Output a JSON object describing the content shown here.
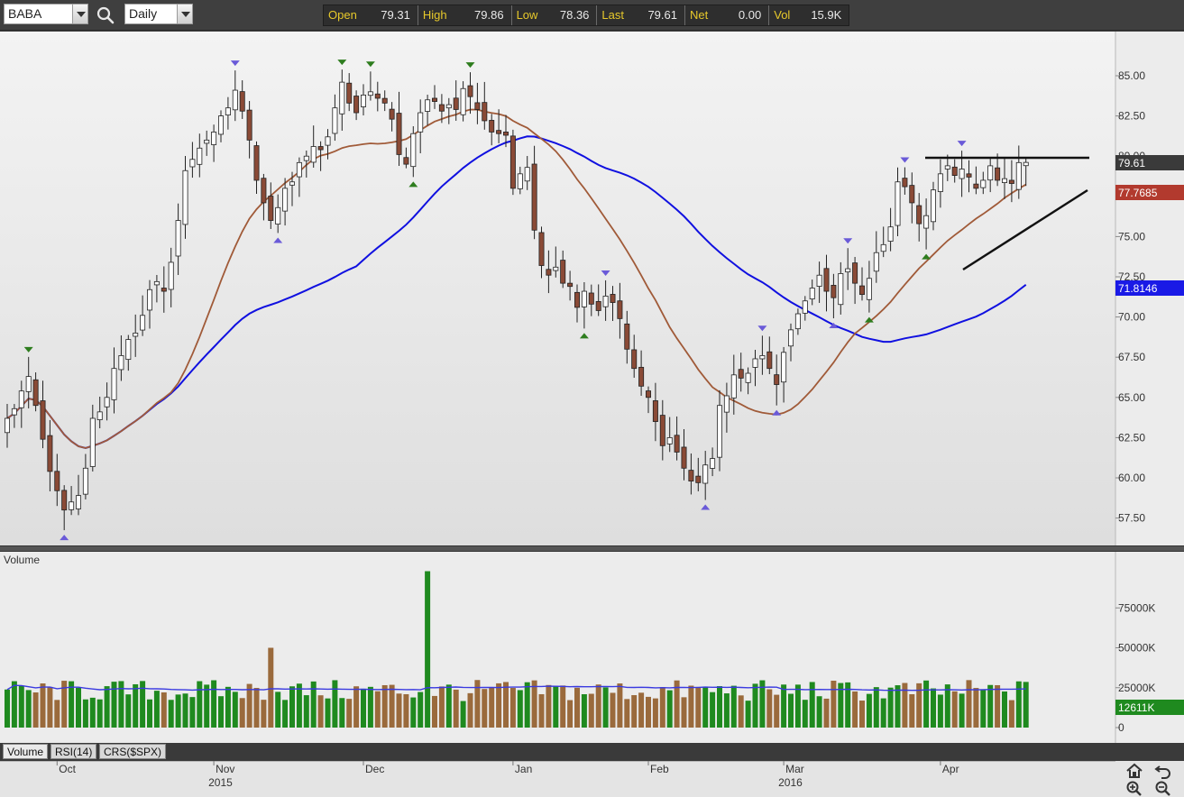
{
  "toolbar": {
    "symbol": "BABA",
    "interval": "Daily",
    "quote": [
      {
        "label": "Open",
        "value": "79.31"
      },
      {
        "label": "High",
        "value": "79.86"
      },
      {
        "label": "Low",
        "value": "78.36"
      },
      {
        "label": "Last",
        "value": "79.61"
      },
      {
        "label": "Net",
        "value": "0.00"
      },
      {
        "label": "Vol",
        "value": "15.9K"
      }
    ]
  },
  "price_panel": {
    "axis_labels": [
      "85.00",
      "82.50",
      "80.00",
      "77.50",
      "75.00",
      "72.50",
      "70.00",
      "67.50",
      "65.00",
      "62.50",
      "60.00",
      "57.50"
    ],
    "last_price_badge": "79.61",
    "sma_fast_badge": "77.7685",
    "sma_slow_badge": "71.8146",
    "colors": {
      "up": "#ffffff",
      "down": "#8a4a36",
      "sma_fast": "#a05a38",
      "sma_slow": "#1010e0",
      "badge_last": "#3a3a3a",
      "badge_fast": "#b23a2e",
      "badge_slow": "#1a1ae6"
    }
  },
  "volume_panel": {
    "title": "Volume",
    "axis_labels": [
      "75000K",
      "50000K",
      "25000K",
      "0"
    ],
    "last_volume_badge": "12611K",
    "colors": {
      "up": "#1f8a1f",
      "down": "#9a6a3c",
      "avg": "#3a3ae0"
    }
  },
  "tabs": [
    "Volume",
    "RSI(14)",
    "CRS($SPX)"
  ],
  "x_axis": {
    "months": [
      "Oct",
      "Nov",
      "Dec",
      "Jan",
      "Feb",
      "Mar",
      "Apr"
    ],
    "years": [
      "2015",
      "2016"
    ]
  },
  "nav": {
    "icons": [
      "home-icon",
      "undo-icon",
      "zoom-in-icon",
      "zoom-out-icon"
    ]
  },
  "chart_data": {
    "type": "candlestick",
    "symbol": "BABA",
    "interval": "Daily",
    "ylim": [
      56,
      87
    ],
    "x": [
      "Sep 22",
      "Sep 23",
      "Sep 24",
      "Sep 25",
      "Sep 28",
      "Sep 29",
      "Sep 30",
      "Oct 1",
      "Oct 2",
      "Oct 5",
      "Oct 6",
      "Oct 7",
      "Oct 8",
      "Oct 9",
      "Oct 12",
      "Oct 13",
      "Oct 14",
      "Oct 15",
      "Oct 16",
      "Oct 19",
      "Oct 20",
      "Oct 21",
      "Oct 22",
      "Oct 23",
      "Oct 26",
      "Oct 27",
      "Oct 28",
      "Oct 29",
      "Oct 30",
      "Nov 2",
      "Nov 3",
      "Nov 4",
      "Nov 5",
      "Nov 6",
      "Nov 9",
      "Nov 10",
      "Nov 11",
      "Nov 12",
      "Nov 13",
      "Nov 16",
      "Nov 17",
      "Nov 18",
      "Nov 19",
      "Nov 20",
      "Nov 23",
      "Nov 24",
      "Nov 25",
      "Nov 27",
      "Nov 30",
      "Dec 1",
      "Dec 2",
      "Dec 3",
      "Dec 4",
      "Dec 7",
      "Dec 8",
      "Dec 9",
      "Dec 10",
      "Dec 11",
      "Dec 14",
      "Dec 15",
      "Dec 16",
      "Dec 17",
      "Dec 18",
      "Dec 21",
      "Dec 22",
      "Dec 23",
      "Dec 24",
      "Dec 28",
      "Dec 29",
      "Dec 30",
      "Dec 31",
      "Jan 4",
      "Jan 5",
      "Jan 6",
      "Jan 7",
      "Jan 8",
      "Jan 11",
      "Jan 12",
      "Jan 13",
      "Jan 14",
      "Jan 15",
      "Jan 19",
      "Jan 20",
      "Jan 21",
      "Jan 22",
      "Jan 25",
      "Jan 26",
      "Jan 27",
      "Jan 28",
      "Jan 29",
      "Feb 1",
      "Feb 2",
      "Feb 3",
      "Feb 4",
      "Feb 5",
      "Feb 8",
      "Feb 9",
      "Feb 10",
      "Feb 11",
      "Feb 12",
      "Feb 16",
      "Feb 17",
      "Feb 18",
      "Feb 19",
      "Feb 22",
      "Feb 23",
      "Feb 24",
      "Feb 25",
      "Feb 26",
      "Feb 29",
      "Mar 1",
      "Mar 2",
      "Mar 3",
      "Mar 4",
      "Mar 7",
      "Mar 8",
      "Mar 9",
      "Mar 10",
      "Mar 11",
      "Mar 14",
      "Mar 15",
      "Mar 16",
      "Mar 17",
      "Mar 18",
      "Mar 21",
      "Mar 22",
      "Mar 23",
      "Mar 24",
      "Mar 28",
      "Mar 29",
      "Mar 30",
      "Mar 31",
      "Apr 1",
      "Apr 4",
      "Apr 5",
      "Apr 6",
      "Apr 7",
      "Apr 8",
      "Apr 11",
      "Apr 12",
      "Apr 13",
      "Apr 14",
      "Apr 15",
      "Apr 18",
      "Apr 19"
    ],
    "close": [
      63.7,
      64.3,
      65.4,
      66.3,
      64.5,
      62.4,
      60.4,
      59.2,
      58.0,
      58.5,
      58.9,
      60.6,
      63.7,
      64.1,
      65.0,
      66.8,
      67.6,
      68.6,
      69.0,
      70.1,
      71.7,
      72.2,
      71.6,
      73.4,
      76.0,
      79.1,
      79.8,
      80.5,
      81.0,
      81.5,
      82.5,
      83.0,
      84.1,
      82.8,
      81.0,
      78.5,
      77.1,
      76.0,
      76.8,
      78.0,
      78.4,
      79.6,
      80.0,
      80.6,
      80.4,
      81.2,
      83.0,
      84.6,
      83.3,
      82.7,
      83.8,
      84.0,
      83.6,
      83.3,
      82.3,
      80.1,
      79.5,
      81.4,
      82.7,
      83.5,
      83.4,
      82.8,
      83.2,
      82.9,
      84.2,
      83.7,
      82.9,
      82.2,
      81.5,
      81.4,
      81.3,
      78.0,
      78.9,
      79.3,
      75.4,
      73.2,
      72.6,
      73.1,
      72.1,
      71.9,
      70.6,
      71.6,
      70.8,
      70.4,
      71.3,
      70.9,
      69.9,
      68.0,
      66.8,
      65.7,
      65.0,
      63.5,
      62.0,
      62.5,
      61.6,
      60.6,
      59.8,
      59.7,
      60.8,
      61.2,
      64.5,
      65.1,
      66.4,
      66.2,
      66.5,
      67.4,
      67.6,
      66.8,
      65.8,
      67.8,
      69.2,
      70.2,
      71.0,
      71.8,
      72.6,
      71.6,
      71.2,
      72.7,
      73.0,
      72.1,
      71.4,
      72.4,
      74.0,
      74.5,
      75.6,
      78.4,
      78.1,
      77.1,
      75.8,
      76.3,
      77.9,
      78.9,
      79.4,
      78.8,
      79.2,
      78.7,
      78.0,
      78.5,
      79.4,
      78.5,
      78.6,
      78.3,
      79.6,
      79.61
    ]
  }
}
